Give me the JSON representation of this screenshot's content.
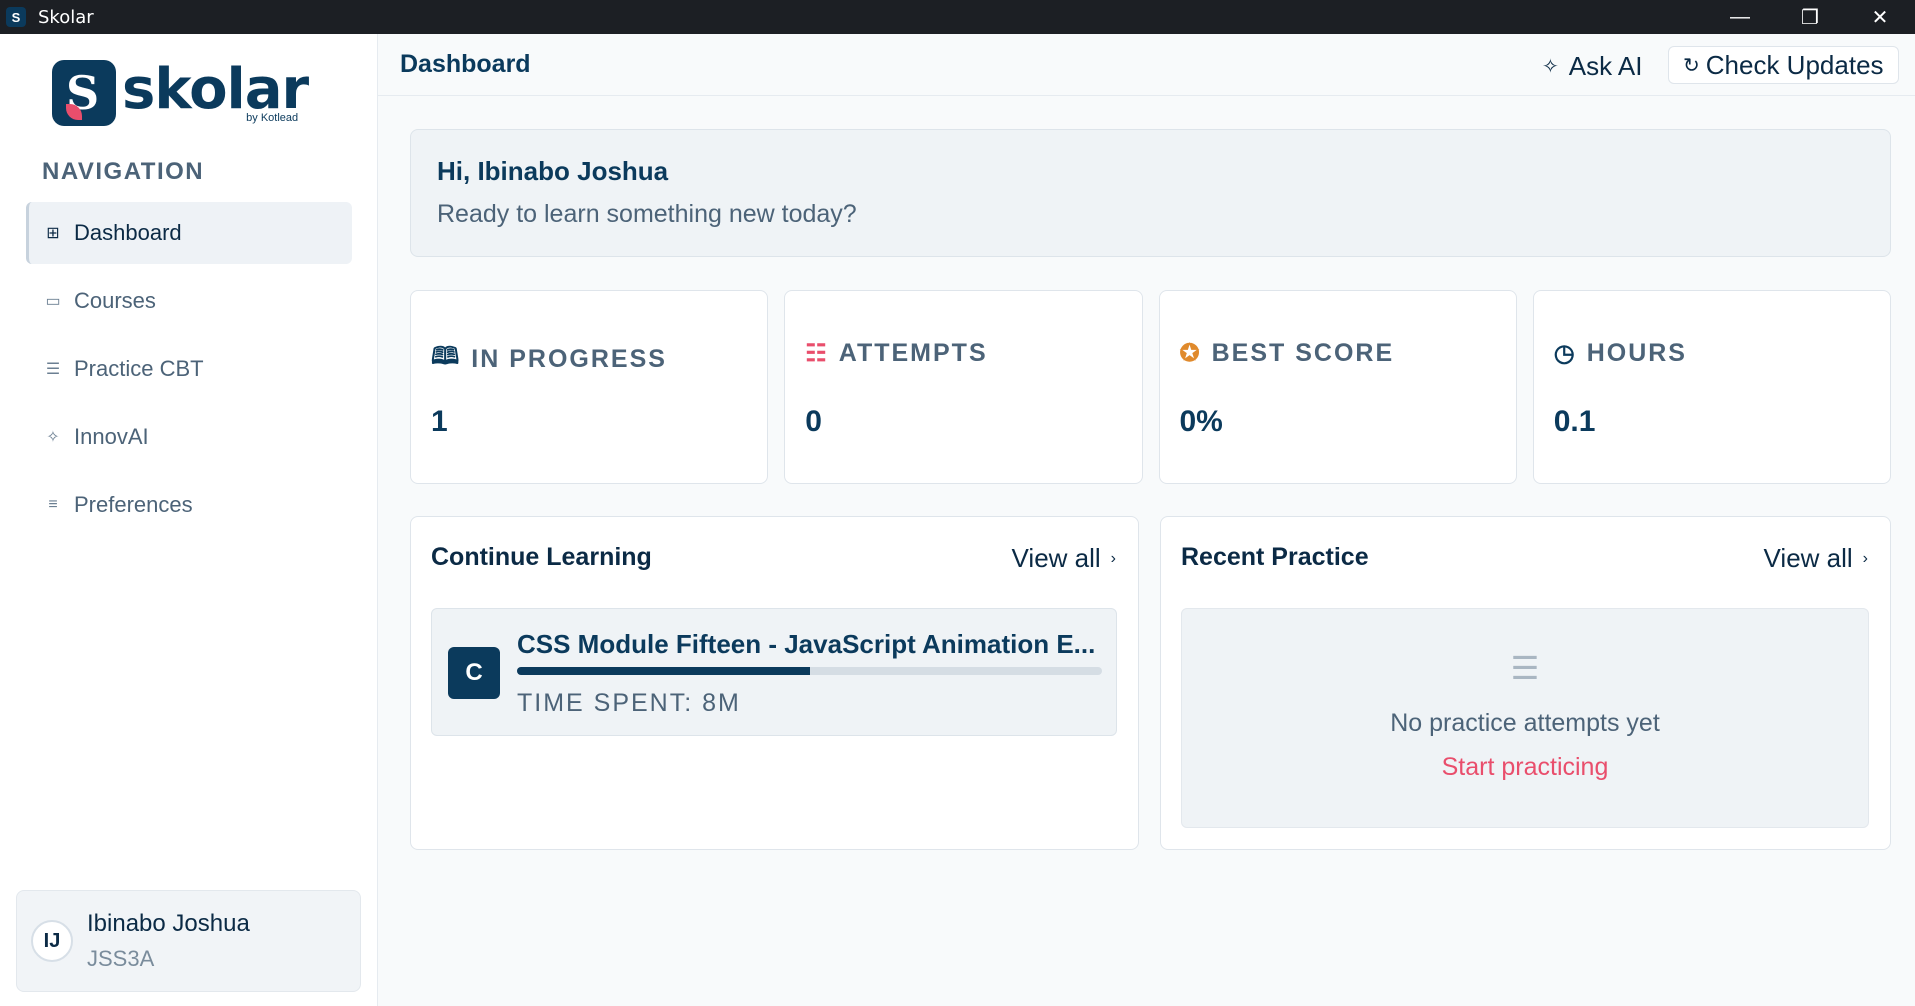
{
  "window": {
    "title": "Skolar",
    "controls": {
      "minimize": "—",
      "maximize": "❐",
      "close": "✕"
    }
  },
  "sidebar": {
    "logo": {
      "word": "skolar",
      "sub": "by Kotlead"
    },
    "nav_heading": "NAVIGATION",
    "items": [
      {
        "label": "Dashboard",
        "icon": "grid-icon",
        "glyph": "⊞",
        "active": true
      },
      {
        "label": "Courses",
        "icon": "book-icon",
        "glyph": "▭"
      },
      {
        "label": "Practice CBT",
        "icon": "list-check-icon",
        "glyph": "☰"
      },
      {
        "label": "InnovAI",
        "icon": "sparkle-icon",
        "glyph": "✧"
      },
      {
        "label": "Preferences",
        "icon": "sliders-icon",
        "glyph": "≡"
      }
    ],
    "user": {
      "initials": "IJ",
      "name": "Ibinabo Joshua",
      "class": "JSS3A"
    }
  },
  "header": {
    "title": "Dashboard",
    "ask_ai": "Ask AI",
    "check_updates": "Check Updates"
  },
  "welcome": {
    "greeting": "Hi, Ibinabo Joshua",
    "subtitle": "Ready to learn something new today?"
  },
  "stats": [
    {
      "label": "IN PROGRESS",
      "value": "1",
      "icon": "book-open-icon",
      "glyph": "🕮",
      "color": "#0b3a5c"
    },
    {
      "label": "ATTEMPTS",
      "value": "0",
      "icon": "list-check-icon",
      "glyph": "☷",
      "color": "#e94e6c"
    },
    {
      "label": "BEST SCORE",
      "value": "0%",
      "icon": "medal-icon",
      "glyph": "✪",
      "color": "#e08a2c"
    },
    {
      "label": "HOURS",
      "value": "0.1",
      "icon": "clock-icon",
      "glyph": "◷",
      "color": "#0b3a5c"
    }
  ],
  "continue_learning": {
    "title": "Continue Learning",
    "view_all": "View all",
    "course": {
      "badge": "C",
      "title": "CSS Module Fifteen - JavaScript Animation E...",
      "progress": 0.5,
      "time_spent": "TIME SPENT: 8M"
    }
  },
  "recent_practice": {
    "title": "Recent Practice",
    "view_all": "View all",
    "empty_message": "No practice attempts yet",
    "cta": "Start practicing"
  },
  "colors": {
    "brand": "#0b3a5c",
    "accent": "#e94e6c"
  }
}
